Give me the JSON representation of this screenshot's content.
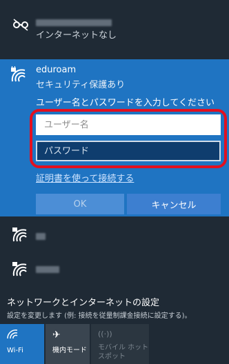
{
  "networks": {
    "top": {
      "status": "インターネットなし"
    },
    "selected": {
      "ssid": "eduroam",
      "security": "セキュリティ保護あり",
      "prompt": "ユーザー名とパスワードを入力してください",
      "username_placeholder": "ユーザー名",
      "password_placeholder": "パスワード",
      "cert_link": "証明書を使って接続する",
      "ok_label": "OK",
      "cancel_label": "キャンセル"
    }
  },
  "settings": {
    "title": "ネットワークとインターネットの設定",
    "description": "設定を変更します (例: 接続を従量制課金接続に設定する)。"
  },
  "tiles": [
    {
      "label": "Wi-Fi",
      "icon": "wifi-icon"
    },
    {
      "label": "機内モード",
      "icon": "airplane-icon"
    },
    {
      "label": "モバイル ホットスポット",
      "icon": "hotspot-icon"
    }
  ],
  "colors": {
    "background": "#1f2a35",
    "accent": "#1f74c2",
    "highlight": "#e3101f"
  }
}
